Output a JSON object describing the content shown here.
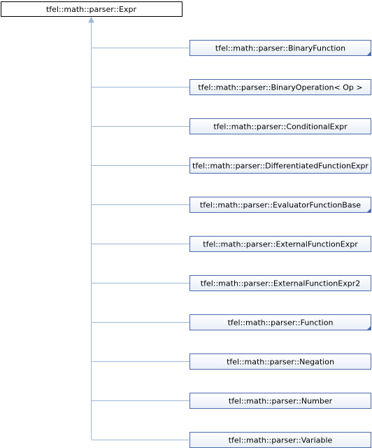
{
  "diagram": {
    "type": "class-inheritance",
    "colors": {
      "base_border": "#000000",
      "base_fill": "#ffffff",
      "child_border": "#4a6aaa",
      "child_fill_top": "#ffffff",
      "child_fill_bottom": "#e8eef7",
      "connector": "#9cb7d8",
      "text": "#000000"
    },
    "base": {
      "label": "tfel::math::parser::Expr"
    },
    "children": [
      {
        "label": "tfel::math::parser::BinaryFunction",
        "has_subclasses": true
      },
      {
        "label": "tfel::math::parser::BinaryOperation< Op >",
        "has_subclasses": false
      },
      {
        "label": "tfel::math::parser::ConditionalExpr",
        "has_subclasses": false
      },
      {
        "label": "tfel::math::parser::DifferentiatedFunctionExpr",
        "has_subclasses": false
      },
      {
        "label": "tfel::math::parser::EvaluatorFunctionBase",
        "has_subclasses": true
      },
      {
        "label": "tfel::math::parser::ExternalFunctionExpr",
        "has_subclasses": false
      },
      {
        "label": "tfel::math::parser::ExternalFunctionExpr2",
        "has_subclasses": false
      },
      {
        "label": "tfel::math::parser::Function",
        "has_subclasses": true
      },
      {
        "label": "tfel::math::parser::Negation",
        "has_subclasses": false
      },
      {
        "label": "tfel::math::parser::Number",
        "has_subclasses": false
      },
      {
        "label": "tfel::math::parser::Variable",
        "has_subclasses": false
      }
    ]
  }
}
